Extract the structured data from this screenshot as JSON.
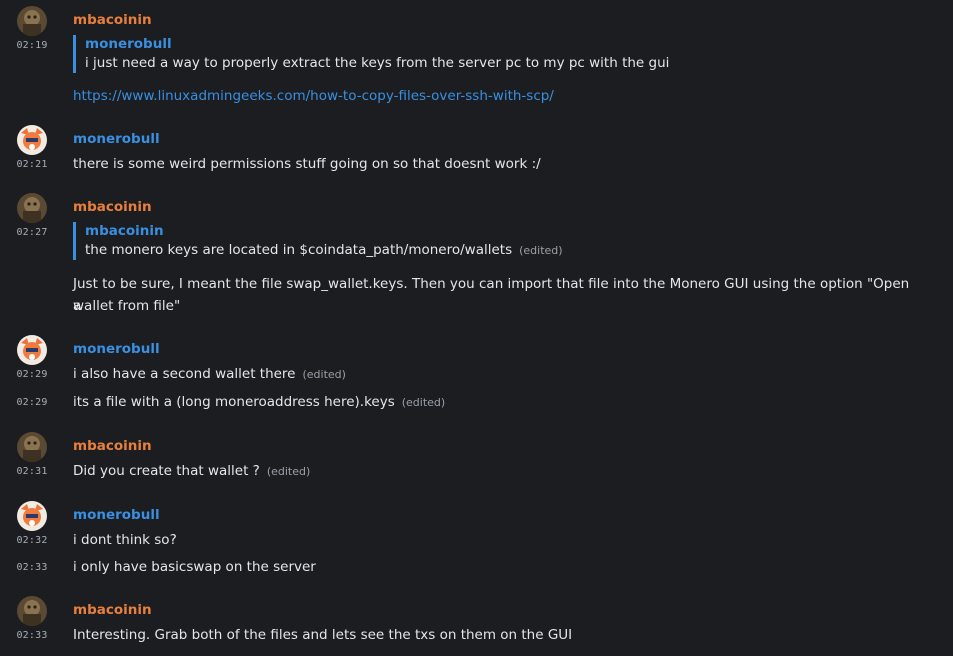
{
  "messages": [
    {
      "author": "mbacoinin",
      "time": "02:19",
      "quote": {
        "author": "monerobull",
        "text": "i just need a way to properly extract the keys from the server pc to my pc with the gui"
      },
      "link": "https://www.linuxadmingeeks.com/how-to-copy-files-over-ssh-with-scp/"
    },
    {
      "author": "monerobull",
      "time": "02:21",
      "text": "there is some weird permissions stuff going on so that doesnt work :/"
    },
    {
      "author": "mbacoinin",
      "time": "02:27",
      "quote": {
        "author": "mbacoinin",
        "text": "the monero keys are located in $coindata_path/monero/wallets",
        "edited": "(edited)"
      },
      "text_line1": "Just to be sure, I meant the file swap_wallet.keys. Then you can import that file into the Monero GUI using the option \"Open a",
      "text_line2": "wallet from file\""
    },
    {
      "author": "monerobull",
      "time": "02:29",
      "text": "i also have a second wallet there",
      "edited": "(edited)",
      "followup": {
        "time": "02:29",
        "text": "its a file with a (long moneroaddress here).keys",
        "edited": "(edited)"
      }
    },
    {
      "author": "mbacoinin",
      "time": "02:31",
      "text": "Did you create that wallet ?",
      "edited": "(edited)"
    },
    {
      "author": "monerobull",
      "time": "02:32",
      "text": "i dont think so?",
      "followup": {
        "time": "02:33",
        "text": "i only have basicswap on the server"
      }
    },
    {
      "author": "mbacoinin",
      "time": "02:33",
      "text": "Interesting. Grab both of the files and lets see the txs on them on the GUI"
    }
  ]
}
